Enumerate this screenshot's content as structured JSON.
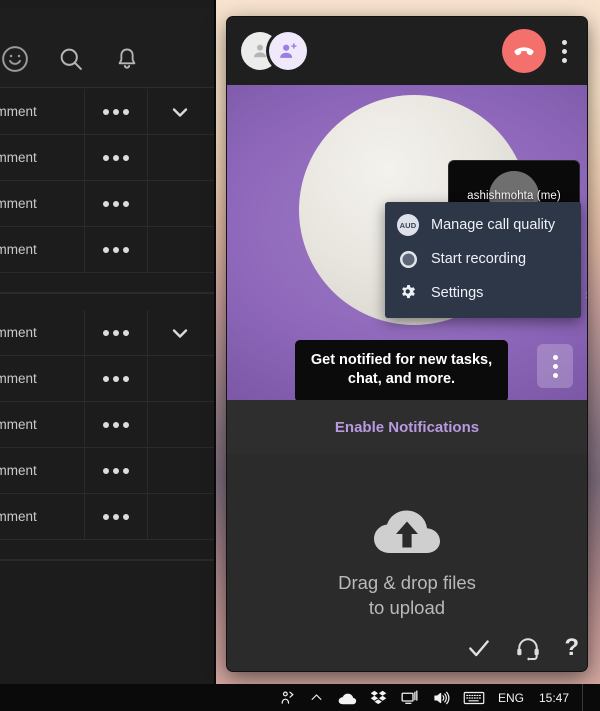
{
  "left_panel": {
    "toolbar_icons": [
      "smiley-icon",
      "search-icon",
      "bell-icon"
    ],
    "groups": [
      {
        "rows": [
          {
            "text": "omment",
            "menu": "more-options",
            "chevron": true
          },
          {
            "text": "omment",
            "menu": "more-options",
            "chevron": false
          },
          {
            "text": "omment",
            "menu": "more-options",
            "chevron": false
          },
          {
            "text": "omment",
            "menu": "more-options",
            "chevron": false
          }
        ]
      },
      {
        "rows": [
          {
            "text": "omment",
            "menu": "more-options",
            "chevron": true
          },
          {
            "text": "omment",
            "menu": "more-options",
            "chevron": false
          },
          {
            "text": "omment",
            "menu": "more-options",
            "chevron": false
          },
          {
            "text": "omment",
            "menu": "more-options",
            "chevron": false
          },
          {
            "text": "omment",
            "menu": "more-options",
            "chevron": false
          }
        ]
      }
    ]
  },
  "call_window": {
    "header": {
      "participant_avatar": "person-icon",
      "add_participant_avatar": "person-add-icon",
      "hangup_label": "hangup-icon",
      "more_label": "more-options-icon"
    },
    "self_view": {
      "name": "ashishmohta (me)",
      "camera_state": "camera-off-icon"
    },
    "context_menu": {
      "items": [
        {
          "icon": "AUD",
          "label": "Manage call quality"
        },
        {
          "icon": "record-icon",
          "label": "Start recording"
        },
        {
          "icon": "gear-icon",
          "label": "Settings"
        }
      ],
      "submenu_arrow": "›"
    },
    "tooltip": {
      "line1": "Get notified for new tasks,",
      "line2": "chat, and more."
    },
    "enable_notifications": {
      "label": "Enable Notifications",
      "color": "#b89ae0"
    },
    "dropzone": {
      "icon": "cloud-upload-icon",
      "line1": "Drag & drop files",
      "line2": "to upload"
    },
    "bottom_icons": [
      {
        "name": "checkmark-icon",
        "glyph": "✓"
      },
      {
        "name": "headset-icon",
        "glyph": ""
      },
      {
        "name": "help-icon",
        "glyph": "?"
      }
    ]
  },
  "taskbar": {
    "tray_icons": [
      "people-icon",
      "show-hidden-icons-chevron",
      "onedrive-icon",
      "dropbox-icon",
      "network-icon",
      "volume-icon",
      "keyboard-icon"
    ],
    "language": "ENG",
    "clock": "15:47"
  },
  "colors": {
    "accent_purple": "#b89ae0",
    "hangup_red": "#f4706c",
    "menu_bg": "#2d3748",
    "stage_purple": "#8f68bb"
  }
}
